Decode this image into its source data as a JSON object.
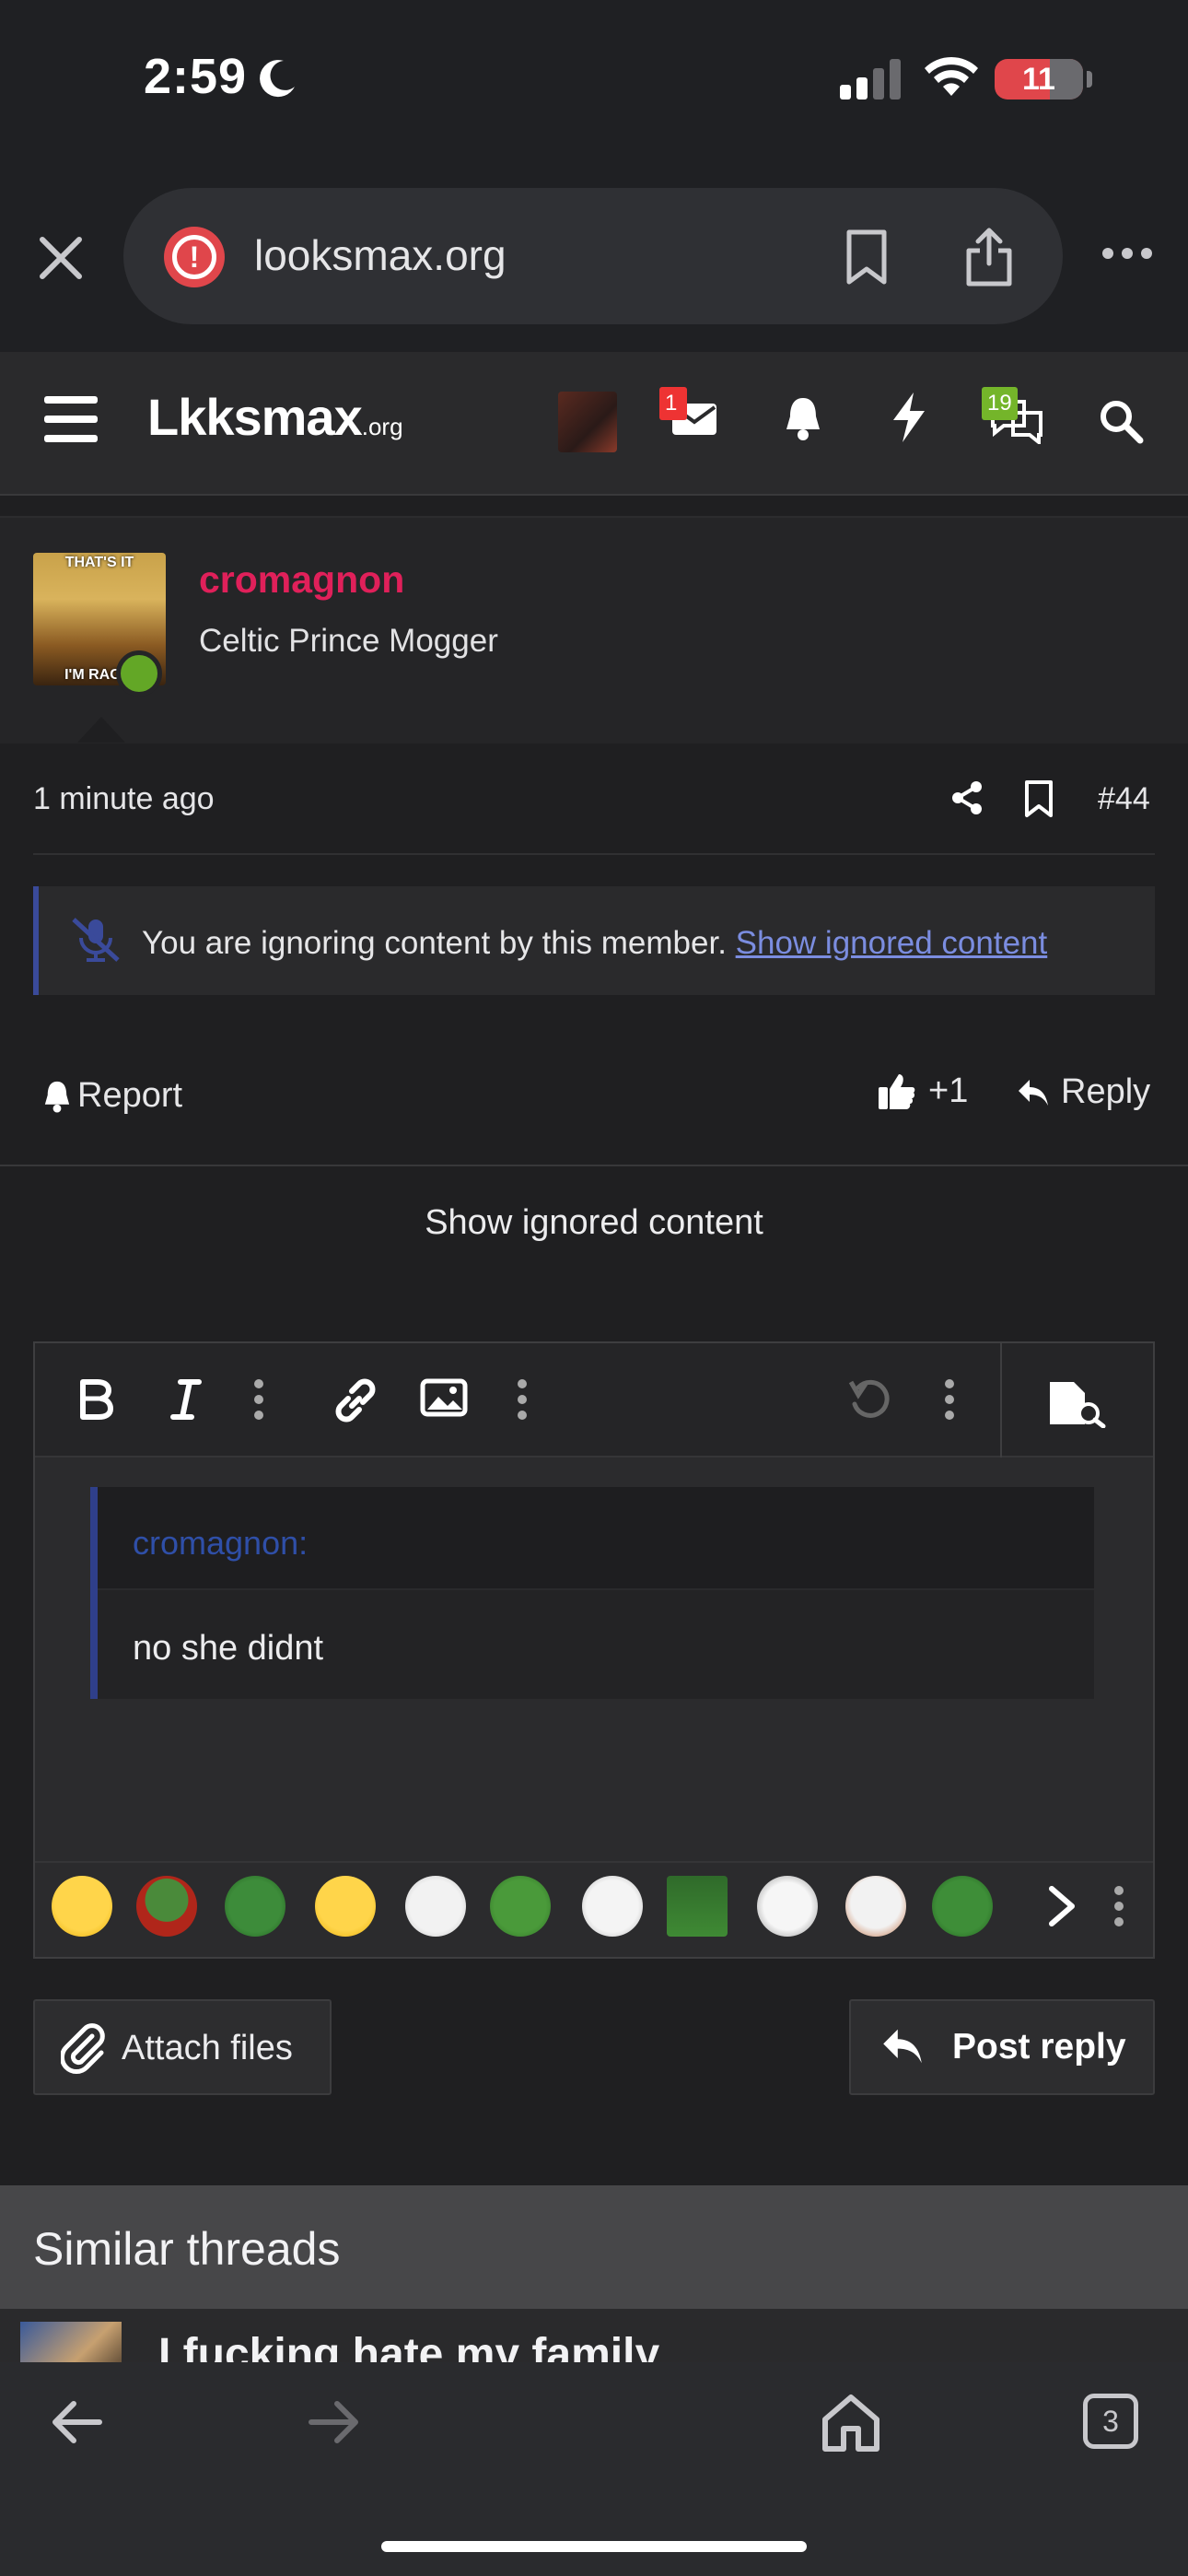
{
  "status": {
    "time": "2:59",
    "battery": "11"
  },
  "browser": {
    "url": "looksmax.org",
    "tabs_count": "3"
  },
  "site": {
    "logo_main": "Lkksmax",
    "logo_suffix": ".org",
    "mail_badge": "1",
    "chat_badge": "19"
  },
  "post": {
    "username": "cromagnon",
    "user_title": "Celtic Prince Mogger",
    "avatar_caption_top": "THAT'S IT",
    "avatar_caption_bottom": "I'M RACIS",
    "time": "1 minute ago",
    "number": "#44",
    "ignore_text": "You are ignoring content by this member.",
    "ignore_link": "Show ignored content",
    "report_label": "Report",
    "like_count": "+1",
    "reply_label": "Reply",
    "show_ignored": "Show ignored content"
  },
  "editor": {
    "quote_author": "cromagnon:",
    "quote_body": "no she didnt"
  },
  "actions": {
    "attach": "Attach files",
    "post_reply": "Post reply"
  },
  "similar": {
    "title": "Similar threads",
    "first_thread": "I fucking hate my family"
  },
  "colors": {
    "accent_username": "#e0205a",
    "online": "#63a726",
    "link": "#7b8de0",
    "quote_bar": "#2f3f8a"
  }
}
